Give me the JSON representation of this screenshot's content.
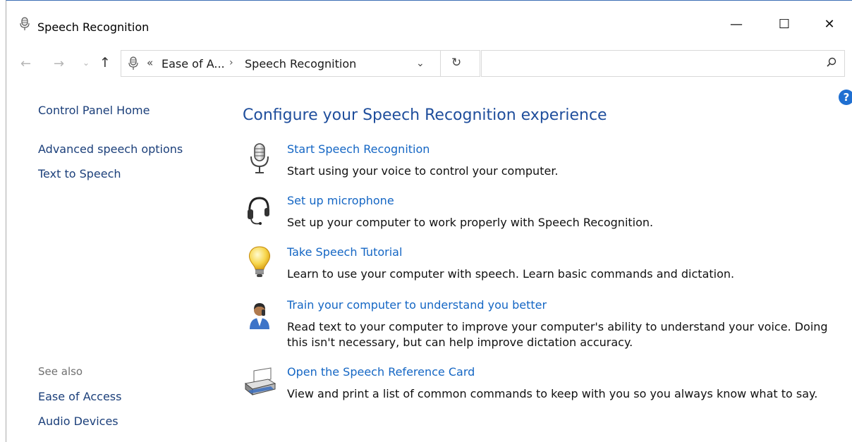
{
  "window": {
    "title": "Speech Recognition",
    "minimize_glyph": "—",
    "maximize_glyph": "☐",
    "close_glyph": "✕"
  },
  "nav": {
    "back_glyph": "←",
    "forward_glyph": "→",
    "recent_glyph": "⌄",
    "up_glyph": "↑",
    "address": {
      "overflow_glyph": "«",
      "crumb1": "Ease of A...",
      "separator": "›",
      "crumb2": "Speech Recognition",
      "dropdown_glyph": "⌄",
      "refresh_glyph": "↻"
    },
    "search": {
      "placeholder": "",
      "value": ""
    }
  },
  "help": {
    "glyph": "?"
  },
  "left_pane": {
    "home": "Control Panel Home",
    "advanced": "Advanced speech options",
    "tts": "Text to Speech",
    "see_also": "See also",
    "ease": "Ease of Access",
    "audio": "Audio Devices"
  },
  "main": {
    "title": "Configure your Speech Recognition experience",
    "tasks": [
      {
        "link": "Start Speech Recognition",
        "desc": "Start using your voice to control your computer.",
        "icon": "microphone-icon"
      },
      {
        "link": "Set up microphone",
        "desc": "Set up your computer to work properly with Speech Recognition.",
        "icon": "headset-icon"
      },
      {
        "link": "Take Speech Tutorial",
        "desc": "Learn to use your computer with speech. Learn basic commands and dictation.",
        "icon": "lightbulb-icon"
      },
      {
        "link": "Train your computer to understand you better",
        "desc1": "Read text to your computer to improve your computer's ability to understand your voice. Doing",
        "desc2": "this isn't necessary, but can help improve dictation accuracy.",
        "icon": "user-icon"
      },
      {
        "link": "Open the Speech Reference Card",
        "desc": "View and print a list of common commands to keep with you so you always know what to say.",
        "icon": "printer-icon"
      }
    ]
  },
  "colors": {
    "link_blue": "#1466c4",
    "title_blue": "#1f4e9c",
    "nav_link": "#1b3f7a",
    "muted_gray": "#707070"
  }
}
